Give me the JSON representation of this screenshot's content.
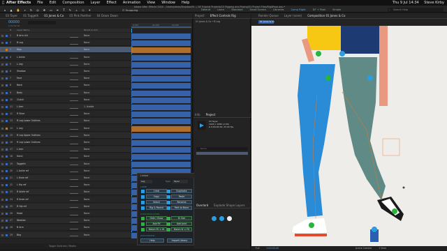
{
  "menubar": {
    "apple_icon": "apple-icon",
    "app_name": "After Effects",
    "items": [
      "File",
      "Edit",
      "Composition",
      "Layer",
      "Effect",
      "Animation",
      "View",
      "Window",
      "Help"
    ],
    "status_right": "Thu 9 Jul 14:34",
    "user": "Steve Kirby"
  },
  "toolbar": {
    "path_title": "Adobe After Effects 2020 - /Users/steve/Dropbox/M.../ AE Tutorial Projects/15 Rigging and Posing/01 Project Files/RigAPose.aep *",
    "snapping": "Snapping",
    "workspaces": [
      "Default",
      "Learn",
      "Standard",
      "Small Screen",
      "Libraries",
      "Comp Right",
      "DF + Pixel",
      "Simple"
    ],
    "search": "Search Help"
  },
  "timeline": {
    "tabs": [
      "03 Tayer",
      "01 Toggeth",
      "01 Jones & Co",
      "05 Pink Panther",
      "04 Down Down"
    ],
    "timecode": "00000",
    "subtimecode": "0:00:00:00",
    "column_headers": [
      "#",
      "Layer Name",
      "Parent & Link"
    ],
    "layers": [
      {
        "num": "1",
        "name": "B Arm ctrl",
        "parent": "None",
        "color": "#3b6dbf"
      },
      {
        "num": "2",
        "name": "B Leg",
        "parent": "None",
        "color": "#3b6dbf"
      },
      {
        "num": "3",
        "name": "Hips",
        "parent": "None",
        "color": "#c87b2e"
      },
      {
        "num": "4",
        "name": "L Ankle",
        "parent": "None",
        "color": "#3b6dbf"
      },
      {
        "num": "5",
        "name": "L Leg",
        "parent": "None",
        "color": "#3b6dbf"
      },
      {
        "num": "6",
        "name": "Shadow",
        "parent": "None",
        "color": "#3b6dbf"
      },
      {
        "num": "7",
        "name": "Face",
        "parent": "None",
        "color": "#3b6dbf"
      },
      {
        "num": "8",
        "name": "Neck",
        "parent": "None",
        "color": "#3b6dbf"
      },
      {
        "num": "9",
        "name": "Body",
        "parent": "None",
        "color": "#3b6dbf"
      },
      {
        "num": "10",
        "name": "Clutch",
        "parent": "None",
        "color": "#3b6dbf"
      },
      {
        "num": "11",
        "name": "L Arm",
        "parent": "1. Arable",
        "color": "#3b6dbf"
      },
      {
        "num": "12",
        "name": "R Shoe",
        "parent": "None",
        "color": "#3b6dbf"
      },
      {
        "num": "13",
        "name": "R Leg Lower Outlines",
        "parent": "None",
        "color": "#3b6dbf"
      },
      {
        "num": "14",
        "name": "L Leg",
        "parent": "None",
        "color": "#c87b2e"
      },
      {
        "num": "15",
        "name": "R Leg Upper Outlines",
        "parent": "None",
        "color": "#3b6dbf"
      },
      {
        "num": "16",
        "name": "R Leg Lower Outlines",
        "parent": "None",
        "color": "#3b6dbf"
      },
      {
        "num": "17",
        "name": "L Arm",
        "parent": "None",
        "color": "#3b6dbf"
      },
      {
        "num": "18",
        "name": "Hand",
        "parent": "None",
        "color": "#3b6dbf"
      },
      {
        "num": "19",
        "name": "Toggeth",
        "parent": "None",
        "color": "#3b6dbf"
      },
      {
        "num": "20",
        "name": "L Ankle ref",
        "parent": "None",
        "color": "#3b6dbf"
      },
      {
        "num": "21",
        "name": "L Knee ref",
        "parent": "None",
        "color": "#3b6dbf"
      },
      {
        "num": "22",
        "name": "L Hip ref",
        "parent": "None",
        "color": "#3b6dbf"
      },
      {
        "num": "23",
        "name": "R Ankle ref",
        "parent": "None",
        "color": "#3b6dbf"
      },
      {
        "num": "24",
        "name": "R Knee ref",
        "parent": "None",
        "color": "#3b6dbf"
      },
      {
        "num": "25",
        "name": "R Hip ref",
        "parent": "None",
        "color": "#3b6dbf"
      },
      {
        "num": "26",
        "name": "Head",
        "parent": "None",
        "color": "#3b6dbf"
      },
      {
        "num": "27",
        "name": "Waistee",
        "parent": "None",
        "color": "#3b6dbf"
      },
      {
        "num": "28",
        "name": "B Arm",
        "parent": "None",
        "color": "#3b6dbf"
      },
      {
        "num": "29",
        "name": "Bkg",
        "parent": "None",
        "color": "#3b6dbf"
      }
    ],
    "ruler_marks": [
      "0:00f",
      "02:00f",
      "04:00f"
    ],
    "footer": "Toggle Switches / Modes"
  },
  "effects": {
    "tabs": [
      "Project",
      "Effect Controls Rig",
      "Composition 01 Jones & Co",
      "Render Queue",
      "Layer (none)"
    ],
    "breadcrumb": "01 Jones & Co • B Leg",
    "comp_tab": "01 Jones & Co"
  },
  "project": {
    "tabs": [
      "Info",
      "Project"
    ],
    "selected_name": "03 Tayer",
    "selected_info_1": "1920 x 1080 (1.00)",
    "selected_info_2": "Δ 0;00;05;00, 25.00 fps",
    "search_placeholder": "Name",
    "items": [
      "03 Tayer",
      "01 Toggeth",
      "01 Jones & Co",
      "05 Pink Panther",
      "04 Down Down",
      "Sources"
    ]
  },
  "limber": {
    "title": "Limber",
    "tab": "Limber",
    "dropdown_left": "Leg",
    "dropdown_label": "Type",
    "dropdown_right": "Tayer",
    "section_limb": "LIMB",
    "section_controllers": "CONTROLLERS",
    "section_advanced": "ADVANCED",
    "buttons_limb": [
      [
        "Limb",
        "Duplicate"
      ],
      [
        "Copy",
        "Paste"
      ],
      [
        "Select",
        "Rename"
      ],
      [
        "Rig & Parent",
        "Path to Bone"
      ]
    ],
    "buttons_controllers": [
      [
        "Hide / Show",
        "IK Size"
      ],
      [
        "Add FK",
        "Add Joint"
      ],
      [
        "Match FK > IK",
        "Match IK > FK"
      ]
    ],
    "buttons_advanced": [
      "Help",
      "Import Library"
    ]
  },
  "overlord": {
    "tabs": [
      "Overlord",
      "Explode Shape Layers"
    ]
  },
  "comp_footer": {
    "zoom": "Full",
    "camera": "Active Camera",
    "view": "1 View",
    "time": "0:00:00:00"
  },
  "colors": {
    "canvas_bg": "#efede9",
    "jeans_blue": "#2a8bd6",
    "jeans_teal": "#5f8a86",
    "skin": "#e89980",
    "shirt_yellow": "#f6c814",
    "shirt_navy": "#1e3a72",
    "shoe_white": "#ffffff",
    "controller_green": "#27b53d",
    "controller_blue": "#2a9ee0"
  }
}
